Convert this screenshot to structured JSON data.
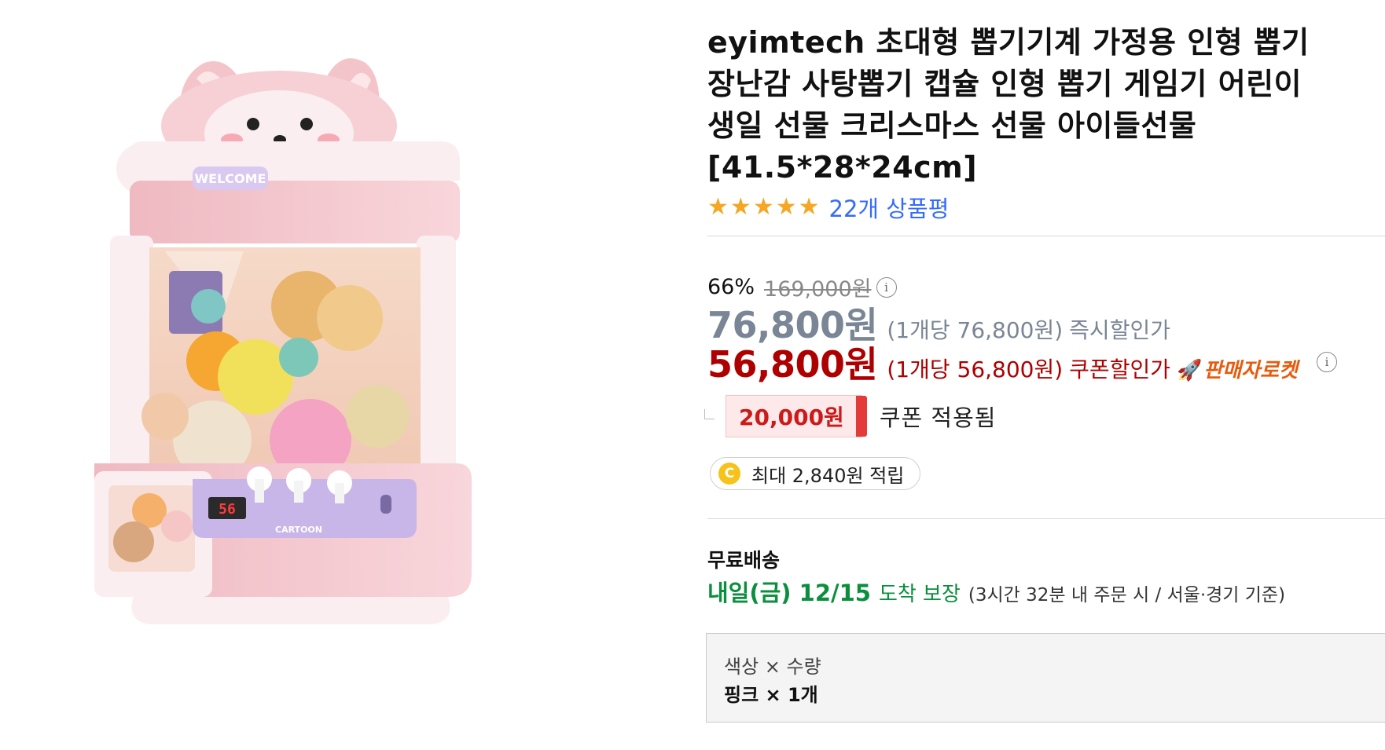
{
  "product": {
    "image_alt": "claw machine toy",
    "image_texts": {
      "welcome": "WELCOME",
      "display": "56",
      "brand_on_panel": "CARTOON"
    },
    "title": "eyimtech 초대형 뽑기기계 가정용 인형 뽑기 장난감 사탕뽑기 캡슐 인형 뽑기 게임기 어린이 생일 선물 크리스마스 선물 아이들선물 [41.5*28*24cm]",
    "title_lines": [
      "eyimtech 초대형 뽑기기계 가정용 인형 뽑기",
      "장난감 사탕뽑기 캡슐 인형 뽑기 게임기 어린이",
      "생일 선물 크리스마스 선물 아이들선물",
      "[41.5*28*24cm]"
    ],
    "rating": {
      "stars": 5,
      "star_glyph": "★",
      "review_text": "22개 상품평"
    }
  },
  "pricing": {
    "discount_rate": "66%",
    "original_price": "169,000원",
    "info_icon": "i",
    "instant": {
      "price": "76,800원",
      "unit_text": "(1개당 76,800원)",
      "label": "즉시할인가"
    },
    "coupon": {
      "price": "56,800원",
      "unit_text": "(1개당 56,800원)",
      "label": "쿠폰할인가",
      "rocket_icon": "🚀",
      "rocket_label": "판매자로켓"
    },
    "coupon_applied": {
      "amount": "20,000원",
      "text": "쿠폰 적용됨"
    },
    "cash": {
      "coin_letter": "C",
      "text": "최대 2,840원 적립"
    }
  },
  "shipping": {
    "label": "무료배송",
    "date": "내일(금) 12/15",
    "guarantee": "도착 보장",
    "note": "(3시간 32분  내 주문 시 / 서울·경기 기준)"
  },
  "option": {
    "head": "색상 × 수량",
    "value": "핑크 × 1개"
  },
  "colors": {
    "accent_red": "#ae0000",
    "instant_gray": "#7a8696",
    "link_blue": "#346aff",
    "delivery_green": "#0a8f3c",
    "star_gold": "#f5a623",
    "rocket_orange": "#e85a0c",
    "machine_pink": "#f2c6cc"
  }
}
